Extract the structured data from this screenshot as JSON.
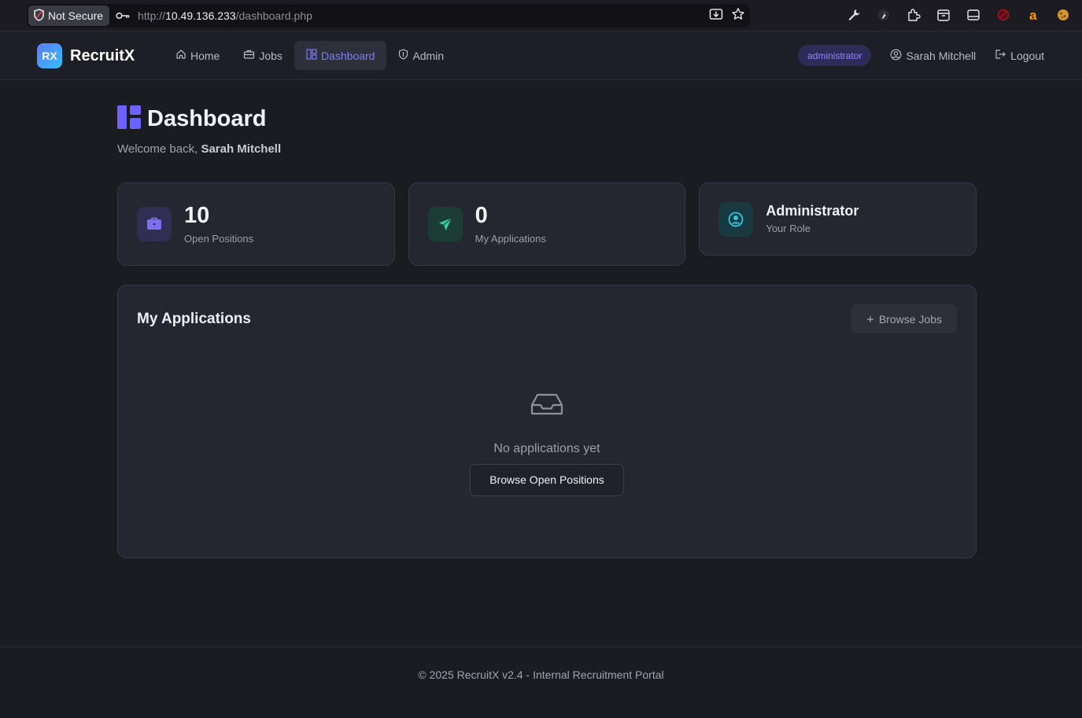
{
  "browser": {
    "security_label": "Not Secure",
    "url_prefix": "http://",
    "url_host": "10.49.136.233",
    "url_path": "/dashboard.php"
  },
  "brand": {
    "logo_text": "RX",
    "name": "RecruitX"
  },
  "nav": {
    "links": [
      {
        "label": "Home"
      },
      {
        "label": "Jobs"
      },
      {
        "label": "Dashboard"
      },
      {
        "label": "Admin"
      }
    ],
    "role_badge": "administrator",
    "user_name": "Sarah Mitchell",
    "logout_label": "Logout"
  },
  "page": {
    "title": "Dashboard",
    "welcome_prefix": "Welcome back, ",
    "welcome_name": "Sarah Mitchell"
  },
  "stats": [
    {
      "value": "10",
      "label": "Open Positions",
      "icon": "briefcase-icon",
      "color": "#7c6ff2"
    },
    {
      "value": "0",
      "label": "My Applications",
      "icon": "send-icon",
      "color": "#2ed19a"
    },
    {
      "value": "Administrator",
      "label": "Your Role",
      "icon": "user-circle-icon",
      "color": "#2ec8e6"
    }
  ],
  "applications": {
    "title": "My Applications",
    "browse_jobs_label": "Browse Jobs",
    "empty_text": "No applications yet",
    "browse_open_label": "Browse Open Positions"
  },
  "footer": {
    "text": "© 2025 RecruitX v2.4 - Internal Recruitment Portal"
  },
  "colors": {
    "accent": "#6c63ff",
    "background": "#1b1c22",
    "card": "#242630"
  }
}
